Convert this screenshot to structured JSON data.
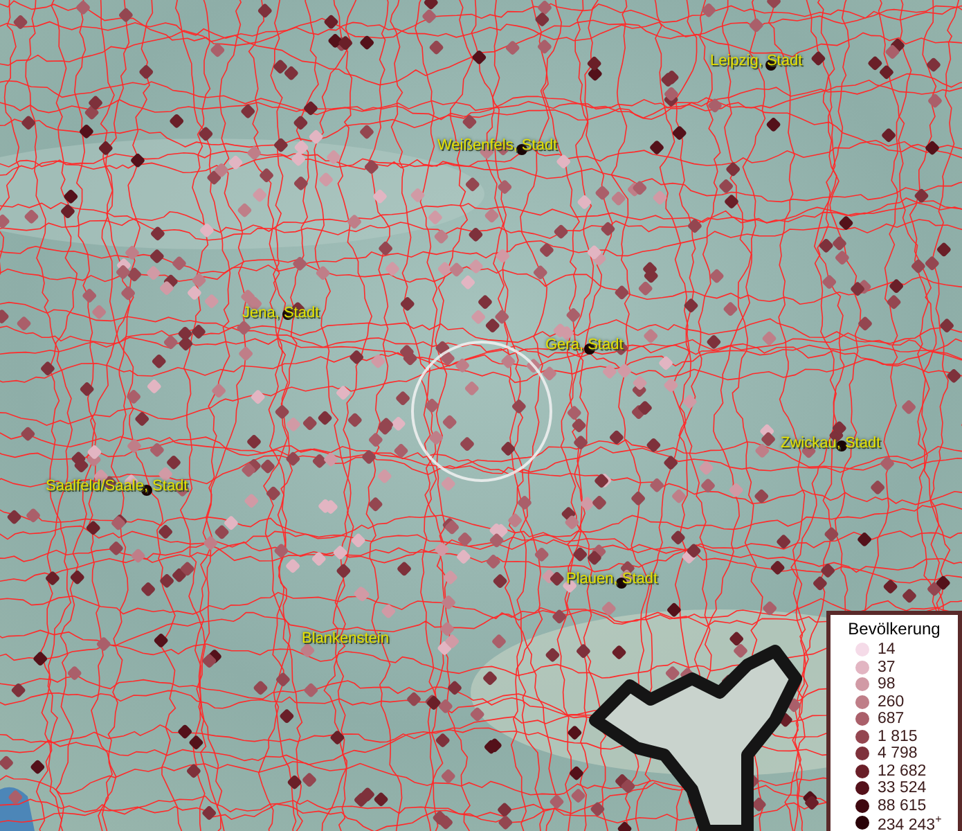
{
  "map": {
    "cities": [
      {
        "name": "Leipzig, Stadt"
      },
      {
        "name": "Weißenfels, Stadt"
      },
      {
        "name": "Jena, Stadt"
      },
      {
        "name": "Gera, Stadt"
      },
      {
        "name": "Zwickau, Stadt"
      },
      {
        "name": "Saalfeld/Saale, Stadt"
      },
      {
        "name": "Plauen, Stadt"
      },
      {
        "name": "Blankenstein"
      }
    ]
  },
  "legend": {
    "title": "Bevölkerung",
    "items": [
      {
        "label": "14",
        "color": "#f5dbe8"
      },
      {
        "label": "37",
        "color": "#e2b5c2"
      },
      {
        "label": "98",
        "color": "#d19aa5"
      },
      {
        "label": "260",
        "color": "#bf7e88"
      },
      {
        "label": "687",
        "color": "#aa5f6a"
      },
      {
        "label": "1 815",
        "color": "#944650"
      },
      {
        "label": "4 798",
        "color": "#7e313b"
      },
      {
        "label": "12 682",
        "color": "#6a1f28"
      },
      {
        "label": "33 524",
        "color": "#54111a"
      },
      {
        "label": "88 615",
        "color": "#3f0810"
      },
      {
        "label": "234 243$^{+}$",
        "color": "#2a0308"
      }
    ]
  }
}
